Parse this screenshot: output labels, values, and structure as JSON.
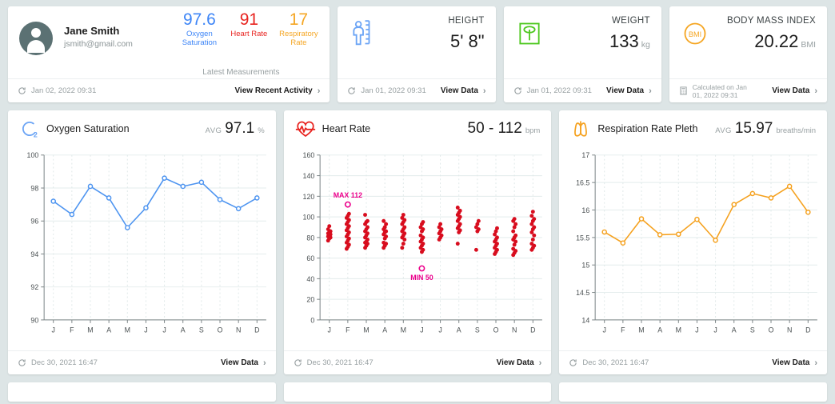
{
  "patient": {
    "name": "Jane Smith",
    "email": "jsmith@gmail.com",
    "latest_label": "Latest Measurements",
    "vitals": [
      {
        "value": "97.6",
        "label": "Oxygen Saturation",
        "color": "#3d85f7"
      },
      {
        "value": "91",
        "label": "Heart Rate",
        "color": "#e8231f"
      },
      {
        "value": "17",
        "label": "Respiratory Rate",
        "color": "#f5a623"
      }
    ],
    "footer": {
      "date": "Jan 02, 2022 09:31",
      "link": "View Recent Activity",
      "chevron": "›"
    }
  },
  "metrics": [
    {
      "icon": "height-ruler-icon",
      "title": "HEIGHT",
      "value": "5' 8\"",
      "unit": "",
      "footer": {
        "date": "Jan 01, 2022 09:31",
        "link": "View Data",
        "chevron": "›"
      }
    },
    {
      "icon": "weight-scale-icon",
      "title": "WEIGHT",
      "value": "133",
      "unit": "kg",
      "footer": {
        "date": "Jan 01, 2022 09:31",
        "link": "View Data",
        "chevron": "›"
      }
    }
  ],
  "bmi": {
    "icon": "bmi-badge-icon",
    "badge_text": "BMI",
    "title": "BODY MASS INDEX",
    "value": "20.22",
    "unit": "BMI",
    "footer": {
      "date_line1": "Calculated on Jan",
      "date_line2": "01, 2022 09:31",
      "link": "View Data",
      "chevron": "›"
    }
  },
  "charts": [
    {
      "icon": "oxygen-saturation-icon",
      "title": "Oxygen Saturation",
      "stat_prefix": "AVG",
      "stat_value": "97.1",
      "stat_unit": "%",
      "footer": {
        "date": "Dec 30, 2021 16:47",
        "link": "View Data",
        "chevron": "›"
      }
    },
    {
      "icon": "heart-rate-icon",
      "title": "Heart Rate",
      "stat_prefix": "",
      "stat_value": "50 - 112",
      "stat_unit": "bpm",
      "footer": {
        "date": "Dec 30, 2021 16:47",
        "link": "View Data",
        "chevron": "›"
      }
    },
    {
      "icon": "respiration-lungs-icon",
      "title": "Respiration Rate Pleth",
      "stat_prefix": "AVG",
      "stat_value": "15.97",
      "stat_unit": "breaths/min",
      "footer": {
        "date": "Dec 30, 2021 16:47",
        "link": "View Data",
        "chevron": "›"
      }
    }
  ],
  "chart_data": [
    {
      "type": "line",
      "title": "Oxygen Saturation",
      "xlabel": "",
      "ylabel": "",
      "categories": [
        "J",
        "F",
        "M",
        "A",
        "M",
        "J",
        "J",
        "A",
        "S",
        "O",
        "N",
        "D"
      ],
      "values": [
        97.2,
        96.4,
        98.1,
        97.4,
        95.6,
        96.8,
        98.6,
        98.1,
        98.35,
        97.3,
        96.75,
        97.4
      ],
      "ylim": [
        90,
        100
      ],
      "yticks": [
        90,
        92,
        94,
        96,
        98,
        100
      ],
      "ytick_labels": [
        "90",
        "92",
        "94",
        "96",
        "98",
        "100"
      ],
      "color": "#4d94f0",
      "marker": "open-circle",
      "grid": true,
      "legend": "none"
    },
    {
      "type": "scatter",
      "title": "Heart Rate",
      "xlabel": "",
      "ylabel": "",
      "categories": [
        "J",
        "F",
        "M",
        "A",
        "M",
        "J",
        "J",
        "A",
        "S",
        "O",
        "N",
        "D"
      ],
      "ylim": [
        0,
        160
      ],
      "yticks": [
        0,
        20,
        40,
        60,
        80,
        100,
        120,
        140,
        160
      ],
      "ytick_labels": [
        "0",
        "20",
        "40",
        "60",
        "80",
        "100",
        "120",
        "140",
        "160"
      ],
      "color": "#d80d1e",
      "grid": true,
      "legend": "none",
      "annotations": [
        {
          "text": "MAX 112",
          "category": "F",
          "value": 112,
          "color": "#ec008c",
          "marker": "open-circle",
          "position": "above"
        },
        {
          "text": "MIN 50",
          "category": "J",
          "value": 50,
          "color": "#ec008c",
          "marker": "open-circle",
          "position": "below"
        }
      ],
      "series_points": [
        {
          "category": "J",
          "values": [
            77,
            79,
            80,
            81,
            82,
            83,
            84,
            85,
            86,
            88,
            91
          ]
        },
        {
          "category": "F",
          "values": [
            69,
            71,
            73,
            75,
            77,
            79,
            81,
            83,
            85,
            87,
            89,
            91,
            93,
            95,
            97,
            99,
            101,
            103,
            112
          ]
        },
        {
          "category": "M",
          "values": [
            70,
            72,
            74,
            75,
            76,
            78,
            80,
            82,
            84,
            86,
            88,
            90,
            93,
            95,
            96,
            102
          ]
        },
        {
          "category": "A",
          "values": [
            70,
            72,
            74,
            75,
            79,
            81,
            83,
            85,
            86,
            88,
            90,
            93,
            96
          ]
        },
        {
          "category": "M",
          "values": [
            70,
            74,
            78,
            80,
            82,
            84,
            86,
            88,
            90,
            93,
            95,
            97,
            99,
            102
          ]
        },
        {
          "category": "J",
          "values": [
            50,
            66,
            68,
            70,
            72,
            74,
            76,
            78,
            80,
            82,
            86,
            88,
            90,
            93,
            95
          ]
        },
        {
          "category": "J",
          "values": [
            78,
            80,
            82,
            84,
            86,
            88,
            90,
            93
          ]
        },
        {
          "category": "A",
          "values": [
            74,
            85,
            87,
            89,
            91,
            93,
            96,
            98,
            100,
            102,
            104,
            106,
            109
          ]
        },
        {
          "category": "S",
          "values": [
            68,
            86,
            88,
            90,
            93,
            96
          ]
        },
        {
          "category": "O",
          "values": [
            64,
            66,
            68,
            70,
            72,
            74,
            76,
            78,
            80,
            83,
            86,
            89
          ]
        },
        {
          "category": "N",
          "values": [
            63,
            65,
            67,
            69,
            73,
            76,
            78,
            80,
            82,
            86,
            90,
            93,
            96,
            98
          ]
        },
        {
          "category": "D",
          "values": [
            68,
            70,
            72,
            74,
            78,
            82,
            85,
            88,
            90,
            93,
            96,
            98,
            101,
            105
          ]
        }
      ]
    },
    {
      "type": "line",
      "title": "Respiration Rate Pleth",
      "xlabel": "",
      "ylabel": "",
      "categories": [
        "J",
        "F",
        "M",
        "A",
        "M",
        "J",
        "J",
        "A",
        "S",
        "O",
        "N",
        "D"
      ],
      "values": [
        15.6,
        15.4,
        15.84,
        15.55,
        15.56,
        15.83,
        15.45,
        16.1,
        16.3,
        16.22,
        16.43,
        15.96
      ],
      "ylim": [
        14,
        17
      ],
      "yticks": [
        14,
        14.5,
        15,
        15.5,
        16,
        16.5,
        17
      ],
      "ytick_labels": [
        "14",
        "14.5",
        "15",
        "15.5",
        "16",
        "16.5",
        "17"
      ],
      "color": "#f5a11e",
      "marker": "open-circle",
      "grid": true,
      "legend": "none"
    }
  ],
  "colors": {
    "background": "#dde5e6",
    "card": "#ffffff",
    "oxygen": "#4d94f0",
    "heart": "#d80d1e",
    "respiration": "#f5a11e",
    "annotation": "#ec008c",
    "avatar": "#5b7173"
  }
}
